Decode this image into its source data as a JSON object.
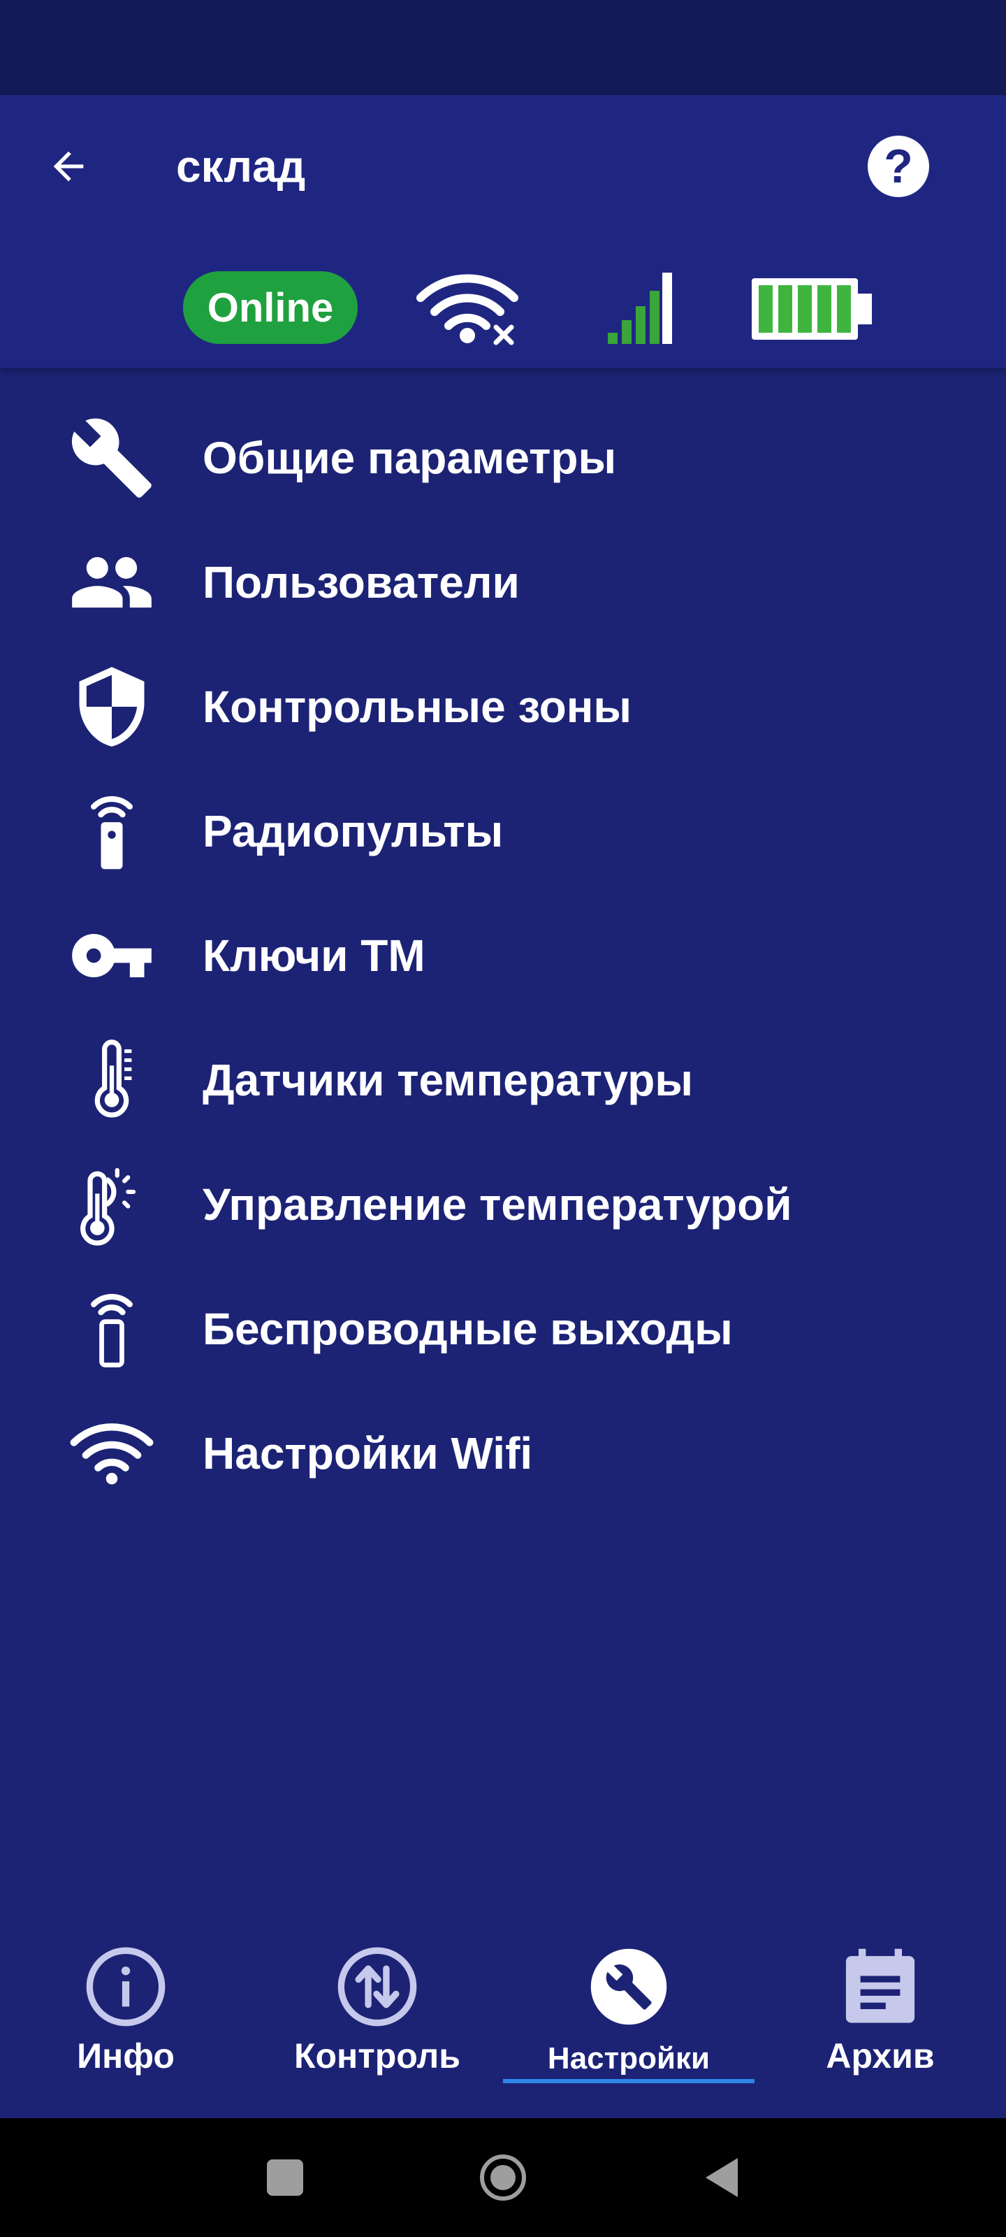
{
  "header": {
    "title": "склад",
    "status": "Online"
  },
  "menu": {
    "items": [
      {
        "label": "Общие параметры",
        "icon": "wrench-icon"
      },
      {
        "label": "Пользователи",
        "icon": "users-icon"
      },
      {
        "label": "Контрольные зоны",
        "icon": "shield-icon"
      },
      {
        "label": "Радиопульты",
        "icon": "remote-control-icon"
      },
      {
        "label": "Ключи ТМ",
        "icon": "key-icon"
      },
      {
        "label": "Датчики температуры",
        "icon": "thermometer-icon"
      },
      {
        "label": "Управление температурой",
        "icon": "thermostat-icon"
      },
      {
        "label": "Беспроводные выходы",
        "icon": "wireless-device-icon"
      },
      {
        "label": "Настройки Wifi",
        "icon": "wifi-icon"
      }
    ]
  },
  "bottom_nav": {
    "items": [
      {
        "label": "Инфо",
        "icon": "info-icon"
      },
      {
        "label": "Контроль",
        "icon": "swap-arrows-icon"
      },
      {
        "label": "Настройки",
        "icon": "wrench-icon"
      },
      {
        "label": "Архив",
        "icon": "calendar-note-icon"
      }
    ],
    "active": "Настройки"
  },
  "colors": {
    "background": "#1c2375",
    "header": "#1f2682",
    "status_bar": "#141a56",
    "online_green": "#1fa13f",
    "signal_green": "#3aa53a",
    "battery_green": "#3fb53f",
    "active_underline": "#2f86ea",
    "inactive_nav": "#c7c9ec"
  }
}
